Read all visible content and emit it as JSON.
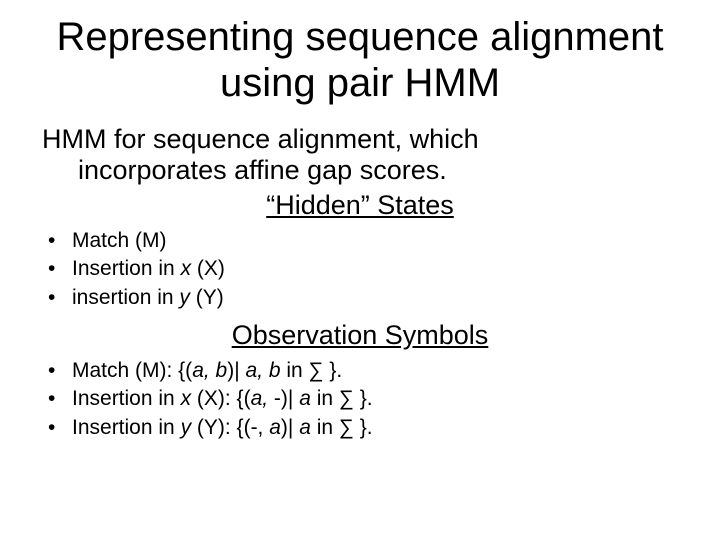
{
  "title": "Representing sequence alignment using pair HMM",
  "intro_line1": "HMM for sequence alignment, which",
  "intro_line2": "incorporates affine gap scores.",
  "section_hidden": "“Hidden” States",
  "hidden": {
    "b0_pre": "Match (M)",
    "b1_pre": "Insertion in ",
    "b1_it": "x",
    "b1_post": " (X)",
    "b2_pre": "insertion in ",
    "b2_it": "y",
    "b2_post": " (Y)"
  },
  "section_obs": "Observation Symbols",
  "obs": {
    "b0_pre": "Match (M): {(",
    "b0_it1": "a, b",
    "b0_mid": ")| ",
    "b0_it2": "a, b",
    "b0_post": " in ∑ }.",
    "b1_pre": "Insertion in ",
    "b1_it1": "x",
    "b1_mid1": " (X): {(",
    "b1_it2": "a,",
    "b1_mid2": " -)| ",
    "b1_it3": "a",
    "b1_post": " in ∑ }.",
    "b2_pre": "Insertion in ",
    "b2_it1": "y",
    "b2_mid1": " (Y): {(-, ",
    "b2_it2": "a",
    "b2_mid2": ")| ",
    "b2_it3": "a",
    "b2_post": " in ∑ }."
  }
}
